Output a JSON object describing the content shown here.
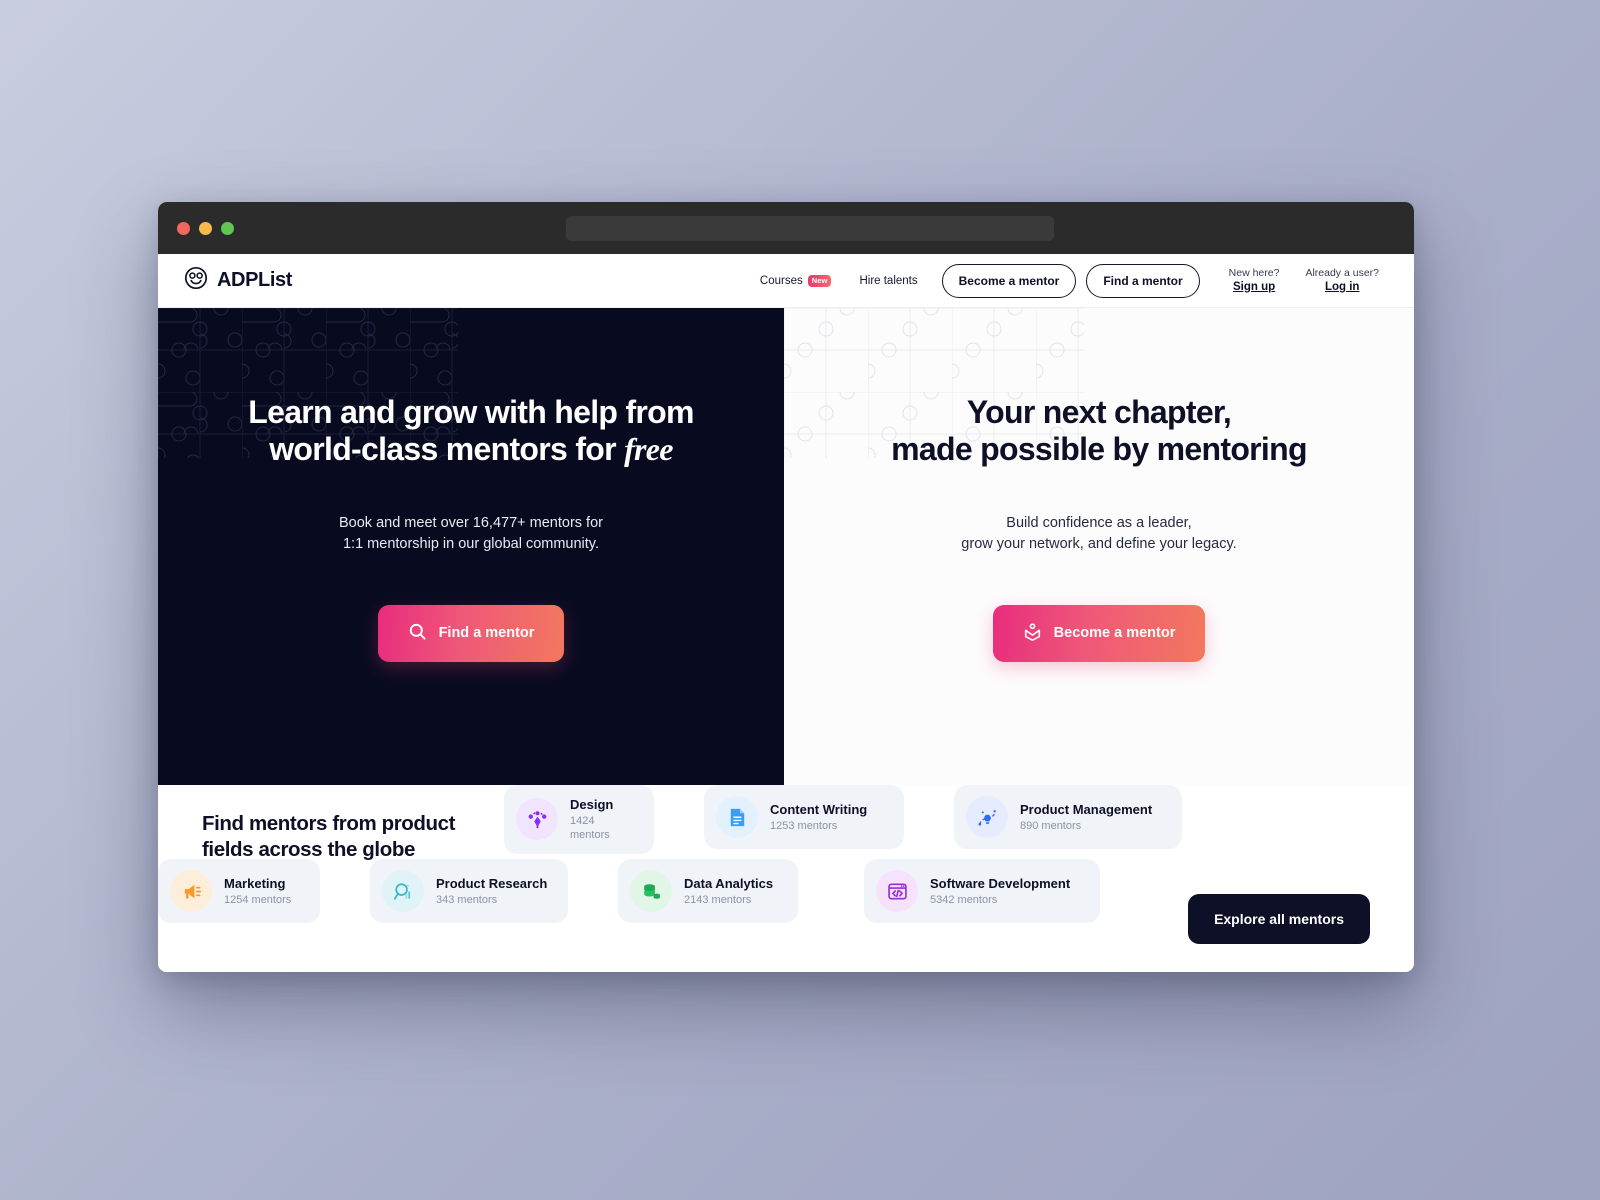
{
  "browser": {
    "url_placeholder": "",
    "traffic_lights": [
      "close-button",
      "minimize-button",
      "maximize-button"
    ]
  },
  "nav": {
    "brand": "ADPList",
    "links": [
      {
        "label": "Courses",
        "badge": "New"
      },
      {
        "label": "Hire talents",
        "badge": ""
      }
    ],
    "become_mentor": "Become a mentor",
    "find_mentor": "Find a mentor",
    "signup_prompt": "New here?",
    "signup_link": "Sign up",
    "login_prompt": "Already a user?",
    "login_link": "Log in"
  },
  "hero_left": {
    "title_line1": "Learn and grow with help from",
    "title_line2_plain": "world-class mentors for ",
    "title_line2_em": "free",
    "sub_line1": "Book and meet over 16,477+ mentors for",
    "sub_line2": "1:1 mentorship in our global community.",
    "cta": "Find a mentor"
  },
  "hero_right": {
    "title_line1": "Your next chapter,",
    "title_line2": "made possible by mentoring",
    "sub_line1": "Build confidence as a leader,",
    "sub_line2": "grow your network, and define your legacy.",
    "cta": "Become a mentor"
  },
  "categories": {
    "heading_line1": "Find mentors from product",
    "heading_line2": "fields across the globe",
    "explore_label": "Explore all mentors",
    "items": [
      {
        "name": "Design",
        "count": "1424 mentors",
        "icon": "pen-tool-icon",
        "color": "#8b2ff0",
        "bg": "#f0e4fe"
      },
      {
        "name": "Content Writing",
        "count": "1253 mentors",
        "icon": "document-icon",
        "color": "#3b9df8",
        "bg": "#e3f1fe"
      },
      {
        "name": "Product Management",
        "count": "890 mentors",
        "icon": "lightbulb-idea-icon",
        "color": "#2f6df0",
        "bg": "#e6ecfd"
      },
      {
        "name": "Marketing",
        "count": "1254 mentors",
        "icon": "megaphone-icon",
        "color": "#f59b2a",
        "bg": "#fdeeda"
      },
      {
        "name": "Product Research",
        "count": "343 mentors",
        "icon": "research-magnifier-icon",
        "color": "#2fb9c9",
        "bg": "#e0f4f7"
      },
      {
        "name": "Data Analytics",
        "count": "2143 mentors",
        "icon": "database-icon",
        "color": "#1faa55",
        "bg": "#e2f6e8"
      },
      {
        "name": "Software Development",
        "count": "5342 mentors",
        "icon": "code-window-icon",
        "color": "#9b2bd6",
        "bg": "#f6e2fd"
      }
    ]
  },
  "colors": {
    "hero_dark_bg": "#080b20",
    "hero_light_bg": "#fcfcfd",
    "accent_gradient_start": "#e82d7e",
    "accent_gradient_end": "#f2785f",
    "ink": "#0d1026",
    "card_bg": "#f0f4f9"
  }
}
